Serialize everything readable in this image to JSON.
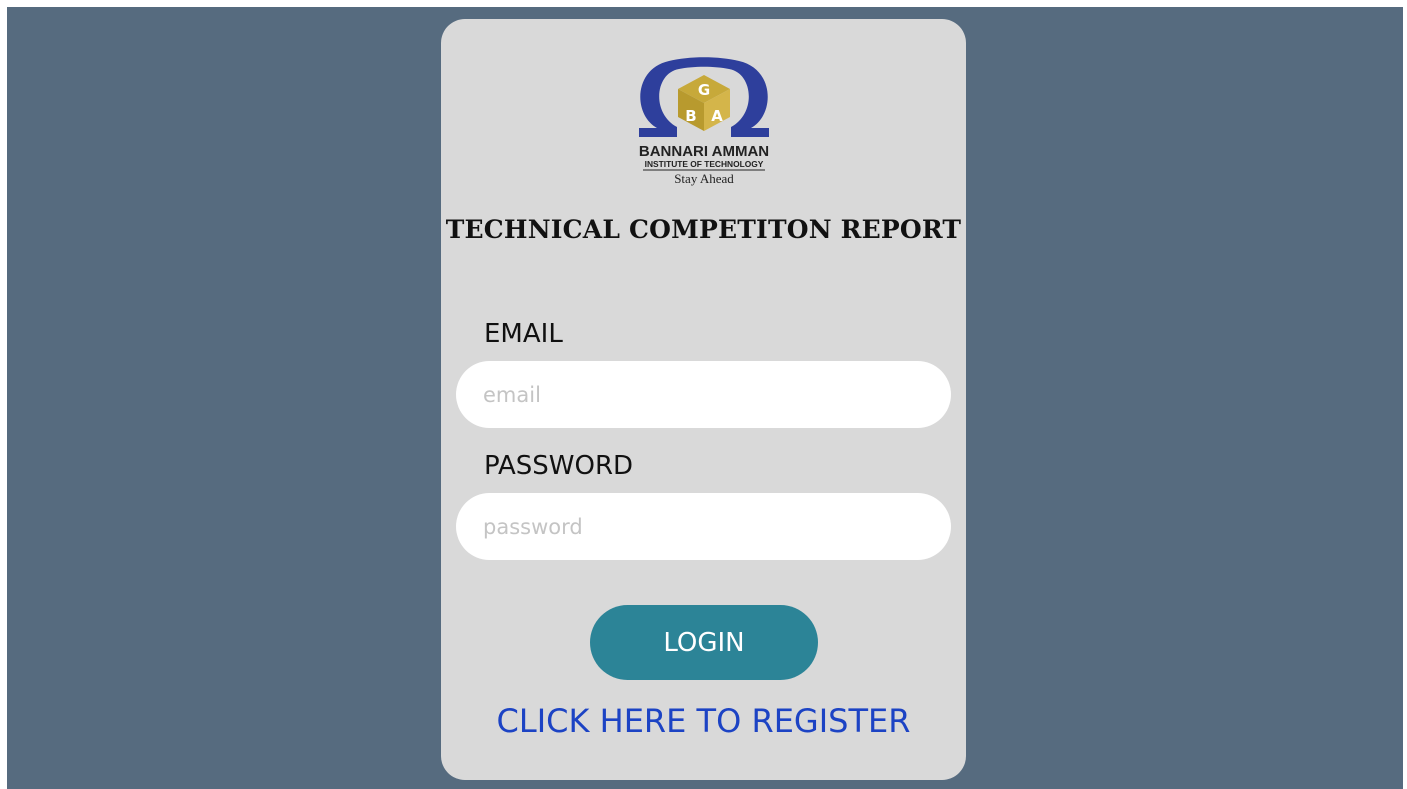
{
  "logo": {
    "name_line1": "BANNARI AMMAN",
    "name_line2": "INSTITUTE OF TECHNOLOGY",
    "tagline": "Stay Ahead",
    "emblem_letters": [
      "G",
      "B",
      "A"
    ],
    "colors": {
      "omega": "#2e3f9c",
      "cube": "#c7a93a"
    }
  },
  "page": {
    "title": "TECHNICAL COMPETITON REPORT"
  },
  "form": {
    "email_label": "EMAIL",
    "email_placeholder": "email",
    "password_label": "PASSWORD",
    "password_placeholder": "password",
    "login_label": "LOGIN",
    "register_link": "CLICK HERE TO REGISTER"
  },
  "colors": {
    "background": "#566b7f",
    "card": "#d9d9d9",
    "button": "#2c8497",
    "link": "#1c43c4"
  }
}
